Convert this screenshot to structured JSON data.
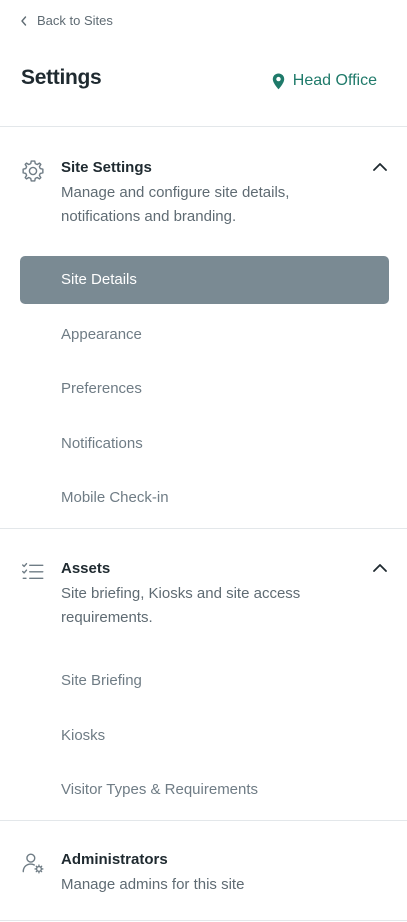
{
  "header": {
    "back_label": "Back to Sites",
    "title": "Settings",
    "site_name": "Head Office"
  },
  "sections": {
    "site_settings": {
      "title": "Site Settings",
      "description": "Manage and configure site details, notifications and branding.",
      "items": [
        "Site Details",
        "Appearance",
        "Preferences",
        "Notifications",
        "Mobile Check-in"
      ],
      "active": "Site Details"
    },
    "assets": {
      "title": "Assets",
      "description": "Site briefing, Kiosks and site access requirements.",
      "items": [
        "Site Briefing",
        "Kiosks",
        "Visitor Types & Requirements"
      ]
    },
    "administrators": {
      "title": "Administrators",
      "description": "Manage admins for this site"
    }
  },
  "colors": {
    "accent": "#1f7a6a",
    "active_bg": "#7a8a93",
    "muted_text": "#6f7c85"
  }
}
